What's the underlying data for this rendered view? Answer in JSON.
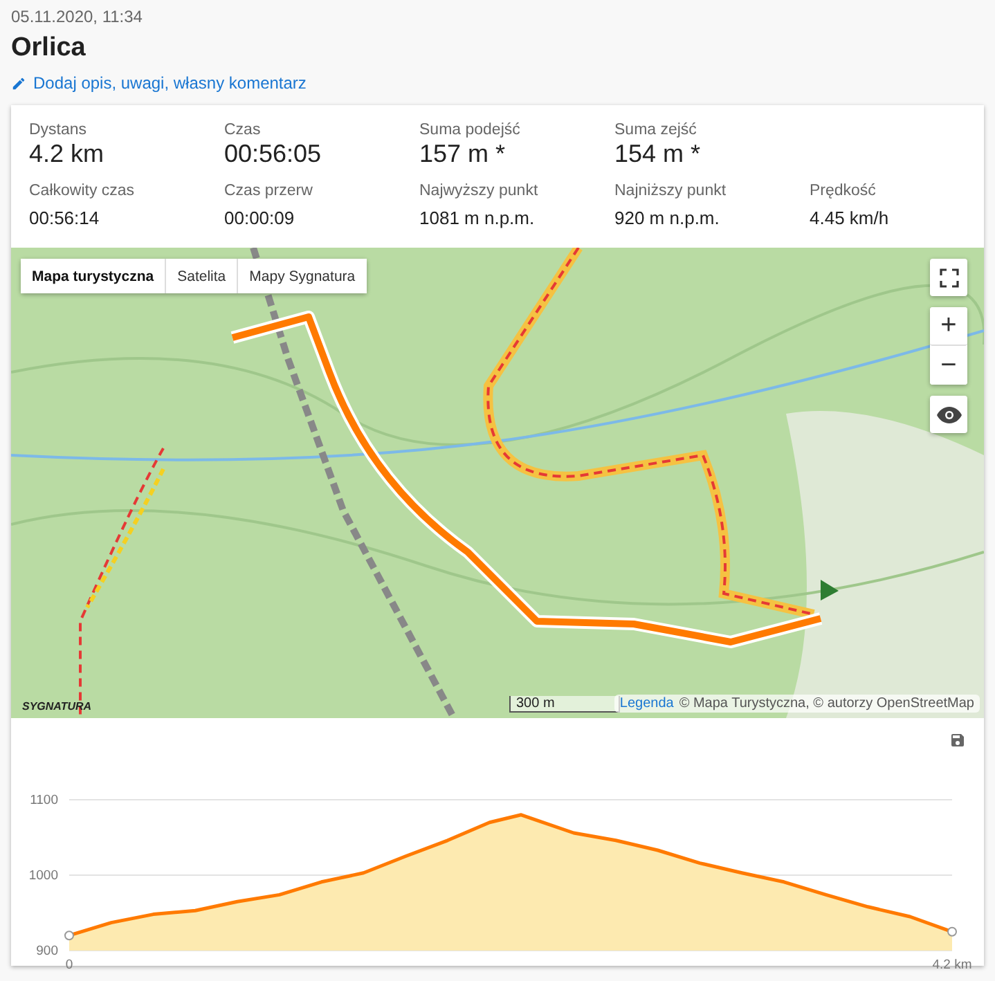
{
  "header": {
    "date": "05.11.2020, 11:34",
    "title": "Orlica",
    "edit_link": "Dodaj opis, uwagi, własny komentarz"
  },
  "stats": [
    {
      "kind": "primary",
      "items": [
        {
          "label": "Dystans",
          "value": "4.2 km"
        },
        {
          "label": "Czas",
          "value": "00:56:05"
        },
        {
          "label": "Suma podejść",
          "value": "157 m *"
        },
        {
          "label": "Suma zejść",
          "value": "154 m *"
        }
      ]
    },
    {
      "kind": "secondary",
      "items": [
        {
          "label": "Całkowity czas",
          "value": "00:56:14"
        },
        {
          "label": "Czas przerw",
          "value": "00:00:09"
        },
        {
          "label": "Najwyższy punkt",
          "value": "1081 m n.p.m."
        },
        {
          "label": "Najniższy punkt",
          "value": "920 m n.p.m."
        },
        {
          "label": "Prędkość",
          "value": "4.45 km/h"
        }
      ]
    }
  ],
  "map": {
    "kind": "picture",
    "layers": [
      {
        "label": "Mapa turystyczna",
        "selected": true
      },
      {
        "label": "Satelita",
        "selected": false
      },
      {
        "label": "Mapy Sygnatura",
        "selected": false
      }
    ],
    "zoom_in": "+",
    "zoom_out": "−",
    "scale": "300 m",
    "legend_link": "Legenda",
    "attribution": "© Mapa Turystyczna, © autorzy OpenStreetMap",
    "logo": "SYGNATURA"
  },
  "profile": {
    "chart_data": {
      "type": "area",
      "x": [
        0,
        0.2,
        0.4,
        0.6,
        0.8,
        1.0,
        1.2,
        1.4,
        1.6,
        1.8,
        2.0,
        2.15,
        2.2,
        2.4,
        2.6,
        2.8,
        3.0,
        3.2,
        3.4,
        3.6,
        3.8,
        4.0,
        4.2
      ],
      "series": [
        {
          "color": "#ff7a00",
          "values": [
            920,
            937,
            948,
            953,
            965,
            974,
            991,
            1003,
            1025,
            1046,
            1070,
            1080,
            1075,
            1056,
            1046,
            1033,
            1016,
            1003,
            991,
            974,
            958,
            945,
            925
          ]
        }
      ],
      "xlim": [
        0,
        4.2
      ],
      "ylim": [
        900,
        1100
      ],
      "xticks": [
        {
          "value": 0,
          "label": "0"
        },
        {
          "value": 4.2,
          "label": "4.2 km"
        }
      ],
      "yticks": [
        900,
        1000,
        1100
      ]
    }
  }
}
